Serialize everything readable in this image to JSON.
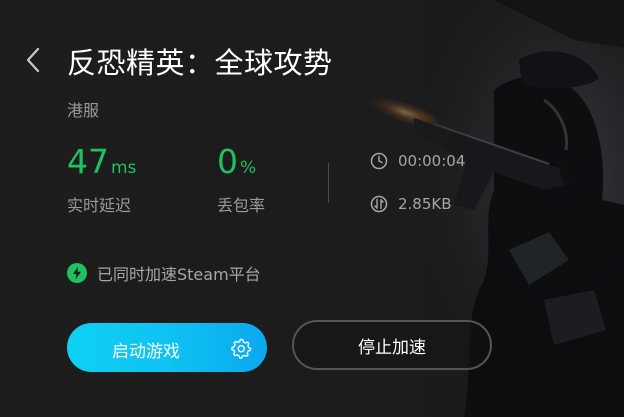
{
  "game": {
    "title": "反恐精英：全球攻势",
    "region": "港服"
  },
  "stats": {
    "latency": {
      "value": "47",
      "unit": "ms",
      "label": "实时延迟"
    },
    "packet_loss": {
      "value": "0",
      "unit": "%",
      "label": "丢包率"
    }
  },
  "session": {
    "duration": "00:00:04",
    "traffic": "2.85KB"
  },
  "steam_note": "已同时加速Steam平台",
  "buttons": {
    "launch": "启动游戏",
    "stop": "停止加速"
  },
  "icons": {
    "back": "chevron-left-icon",
    "clock": "clock-icon",
    "traffic": "traffic-icon",
    "bolt": "lightning-icon",
    "settings": "gear-icon"
  },
  "colors": {
    "accent_green": "#1fc160",
    "launch_blue": "#0fc2f2",
    "background": "#1c1c1c"
  }
}
